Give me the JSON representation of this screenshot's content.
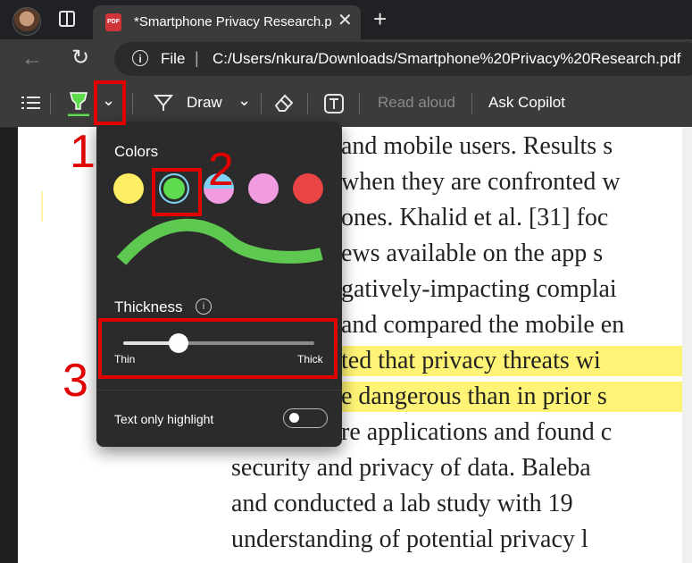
{
  "browser": {
    "tab_title": "*Smartphone Privacy Research.pdf",
    "tab_icon_label": "PDF",
    "close_glyph": "✕",
    "newtab_glyph": "+",
    "back_glyph": "←",
    "refresh_glyph": "↻",
    "info_glyph": "i",
    "scheme_label": "File",
    "separator": "|",
    "url": "C:/Users/nkura/Downloads/Smartphone%20Privacy%20Research.pdf"
  },
  "toolbar": {
    "draw_label": "Draw",
    "read_aloud_label": "Read aloud",
    "ask_copilot_label": "Ask Copilot",
    "chevron_glyph": "⌄"
  },
  "flyout": {
    "colors_title": "Colors",
    "swatches": [
      {
        "name": "yellow",
        "color": "#ffed63"
      },
      {
        "name": "green",
        "color": "#5fdb4f",
        "selected": true
      },
      {
        "name": "blue-half",
        "color": "#7fd3f5"
      },
      {
        "name": "pink",
        "color": "#f19be0"
      },
      {
        "name": "red",
        "color": "#eb4444"
      }
    ],
    "stroke_color": "#5ec850",
    "thickness_title": "Thickness",
    "thickness_info_glyph": "i",
    "thickness_level": 0.29,
    "thin_label": "Thin",
    "thick_label": "Thick",
    "text_only_label": "Text only highlight",
    "text_only_on": false
  },
  "annotations": [
    "1",
    "2",
    "3"
  ],
  "document": {
    "highlight_color": "#fff475",
    "lines": [
      "and mobile users. Results s",
      "when they are confronted w",
      "ones. Khalid et al. [31] foc",
      "ews available on the app s",
      "gatively-impacting complai",
      "and compared the mobile en",
      "ted that privacy threats wi",
      "e dangerous than in prior s",
      "re applications and found c",
      "security and privacy of data. Baleba",
      "and conducted a lab study with 19",
      "understanding of potential privacy l"
    ]
  }
}
